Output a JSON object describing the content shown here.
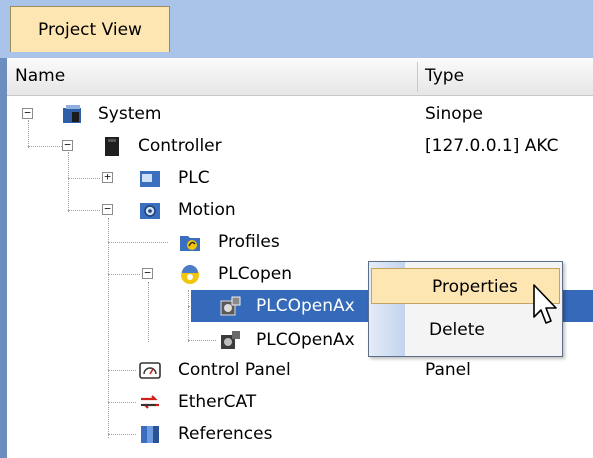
{
  "tab": {
    "label": "Project View"
  },
  "columns": {
    "name": "Name",
    "type": "Type"
  },
  "tree": {
    "system": {
      "label": "System",
      "type": "Sinope"
    },
    "controller": {
      "label": "Controller",
      "type": "[127.0.0.1] AKC"
    },
    "plc": {
      "label": "PLC"
    },
    "motion": {
      "label": "Motion"
    },
    "profiles": {
      "label": "Profiles"
    },
    "plcopen": {
      "label": "PLCopen"
    },
    "axis1": {
      "label": "PLCOpenAx"
    },
    "axis2": {
      "label": "PLCOpenAx"
    },
    "control_panel": {
      "label": "Control Panel",
      "type": "Panel"
    },
    "ethercat": {
      "label": "EtherCAT"
    },
    "references": {
      "label": "References"
    }
  },
  "context_menu": {
    "properties": "Properties",
    "delete": "Delete"
  }
}
